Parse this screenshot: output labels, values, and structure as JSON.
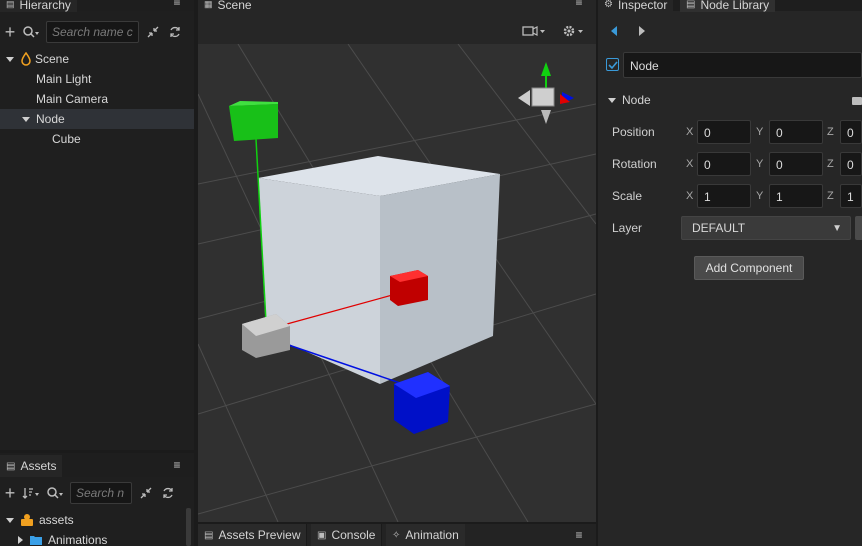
{
  "hierarchy": {
    "tab_label": "Hierarchy",
    "search_placeholder": "Search name c",
    "items": [
      {
        "label": "Scene"
      },
      {
        "label": "Main Light"
      },
      {
        "label": "Main Camera"
      },
      {
        "label": "Node"
      },
      {
        "label": "Cube"
      }
    ]
  },
  "assets": {
    "tab_label": "Assets",
    "search_placeholder": "Search n",
    "items": [
      {
        "label": "assets"
      },
      {
        "label": "Animations"
      }
    ]
  },
  "scene": {
    "tab_label": "Scene",
    "gizmo_colors": {
      "x": "#e00000",
      "y": "#10d010",
      "z": "#0010e0"
    }
  },
  "bottom_tabs": [
    {
      "label": "Assets Preview"
    },
    {
      "label": "Console"
    },
    {
      "label": "Animation"
    }
  ],
  "inspector": {
    "tabs": [
      {
        "label": "Inspector"
      },
      {
        "label": "Node Library"
      }
    ],
    "node_name": "Node",
    "node_active": true,
    "section_title": "Node",
    "properties": [
      {
        "label": "Position",
        "x": "0",
        "y": "0",
        "z": "0"
      },
      {
        "label": "Rotation",
        "x": "0",
        "y": "0",
        "z": "0"
      },
      {
        "label": "Scale",
        "x": "1",
        "y": "1",
        "z": "1"
      }
    ],
    "axis_labels": {
      "x": "X",
      "y": "Y",
      "z": "Z"
    },
    "layer_label": "Layer",
    "layer_value": "DEFAULT",
    "add_component_label": "Add Component"
  }
}
